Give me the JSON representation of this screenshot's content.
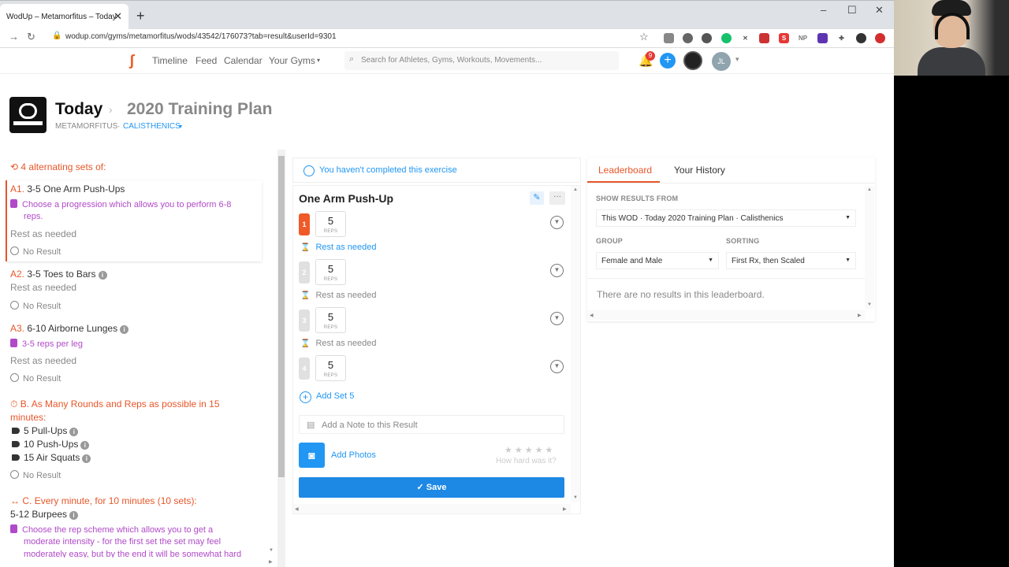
{
  "browser": {
    "tab_title": "WodUp – Metamorfitus – Today",
    "tab_close": "✕",
    "new_tab": "+",
    "url": "wodup.com/gyms/metamorfitus/wods/43542/176073?tab=result&userId=9301",
    "win_min": "–",
    "win_max": "☐",
    "win_close": "✕"
  },
  "nav": {
    "links": [
      "Timeline",
      "Feed",
      "Calendar",
      "Your Gyms"
    ],
    "search_placeholder": "Search for Athletes, Gyms, Workouts, Movements...",
    "notif_count": "9",
    "avatar_initials": "JL"
  },
  "header": {
    "title": "Today",
    "plan": "2020 Training Plan",
    "gym": "METAMORFITUS",
    "track": "CALISTHENICS"
  },
  "workout": {
    "section_a": "4 alternating sets of:",
    "items": [
      {
        "code": "A1.",
        "name": "3-5 One Arm Push-Ups",
        "note": "Choose a progression which allows you to perform 6-8",
        "note2": "reps.",
        "rest": "Rest as needed",
        "result": "No Result"
      },
      {
        "code": "A2.",
        "name": "3-5 Toes to Bars",
        "rest": "Rest as needed",
        "result": "No Result"
      },
      {
        "code": "A3.",
        "name": "6-10 Airborne Lunges",
        "note": "3-5 reps per leg",
        "rest": "Rest as needed",
        "result": "No Result"
      }
    ],
    "section_b_code": "B.",
    "section_b": "As Many Rounds and Reps as possible in 15",
    "section_b2": "minutes:",
    "b_movements": [
      "5 Pull-Ups",
      "10 Push-Ups",
      "15 Air Squats"
    ],
    "b_result": "No Result",
    "section_c_code": "C.",
    "section_c": "Every minute, for 10 minutes (10 sets):",
    "c_movement": "5-12 Burpees",
    "c_note": "Choose the rep scheme which allows you to get a",
    "c_note2": "moderate intensity - for the first set the set may feel",
    "c_note3": "moderately easy, but by the end it will be somewhat hard"
  },
  "exercise": {
    "status": "You haven't completed this exercise",
    "title": "One Arm Push-Up",
    "sets": [
      {
        "num": "1",
        "reps": "5",
        "unit": "REPS"
      },
      {
        "num": "2",
        "reps": "5",
        "unit": "REPS"
      },
      {
        "num": "3",
        "reps": "5",
        "unit": "REPS"
      },
      {
        "num": "4",
        "reps": "5",
        "unit": "REPS"
      }
    ],
    "rest_label": "Rest as needed",
    "add_set": "Add Set 5",
    "note_placeholder": "Add a Note to this Result",
    "add_photos": "Add Photos",
    "stars": "★★★★★",
    "how_hard": "How hard was it?",
    "save": "Save"
  },
  "leaderboard": {
    "tabs": [
      "Leaderboard",
      "Your History"
    ],
    "show_from_label": "SHOW RESULTS FROM",
    "show_from_value": "This WOD · Today 2020 Training Plan · Calisthenics",
    "group_label": "GROUP",
    "group_value": "Female and Male",
    "sorting_label": "SORTING",
    "sorting_value": "First Rx, then Scaled",
    "empty": "There are no results in this leaderboard."
  },
  "colors": {
    "accent_orange": "#e8562a",
    "accent_blue": "#2196f3",
    "purple_note": "#b04ac8",
    "set1": "#f05a28",
    "set_inactive": "#d9d9d9"
  }
}
